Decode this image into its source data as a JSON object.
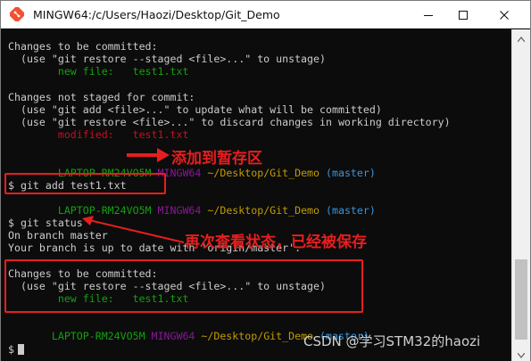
{
  "window": {
    "title": "MINGW64:/c/Users/Haozi/Desktop/Git_Demo"
  },
  "terminal": {
    "lines": [
      {
        "segments": [
          {
            "t": "Changes to be committed:",
            "c": "w"
          }
        ]
      },
      {
        "segments": [
          {
            "t": "  (use \"git restore --staged <file>...\" to unstage)",
            "c": "w"
          }
        ]
      },
      {
        "segments": [
          {
            "t": "        new file:   test1.txt",
            "c": "g"
          }
        ]
      },
      {
        "segments": [
          {
            "t": "",
            "c": "w"
          }
        ]
      },
      {
        "segments": [
          {
            "t": "Changes not staged for commit:",
            "c": "w"
          }
        ]
      },
      {
        "segments": [
          {
            "t": "  (use \"git add <file>...\" to update what will be committed)",
            "c": "w"
          }
        ]
      },
      {
        "segments": [
          {
            "t": "  (use \"git restore <file>...\" to discard changes in working directory)",
            "c": "w"
          }
        ]
      },
      {
        "segments": [
          {
            "t": "        modified:   test1.txt",
            "c": "r"
          }
        ]
      },
      {
        "segments": [
          {
            "t": "",
            "c": "w"
          }
        ]
      },
      {
        "segments": [
          {
            "t": "",
            "c": "w"
          }
        ]
      },
      {
        "segments": [
          {
            "t": "        LAPTOP-RM24VO5M ",
            "c": "g"
          },
          {
            "t": "MINGW64 ",
            "c": "m"
          },
          {
            "t": "~/Desktop/Git_Demo ",
            "c": "y"
          },
          {
            "t": "(master)",
            "c": "c"
          }
        ]
      },
      {
        "segments": [
          {
            "t": "$ git add test1.txt",
            "c": "w"
          }
        ]
      },
      {
        "segments": [
          {
            "t": "",
            "c": "w"
          }
        ]
      },
      {
        "segments": [
          {
            "t": "        LAPTOP-RM24VO5M ",
            "c": "g"
          },
          {
            "t": "MINGW64 ",
            "c": "m"
          },
          {
            "t": "~/Desktop/Git_Demo ",
            "c": "y"
          },
          {
            "t": "(master)",
            "c": "c"
          }
        ]
      },
      {
        "segments": [
          {
            "t": "$ git status",
            "c": "w"
          }
        ]
      },
      {
        "segments": [
          {
            "t": "On branch master",
            "c": "w"
          }
        ]
      },
      {
        "segments": [
          {
            "t": "Your branch is up to date with 'origin/master'.",
            "c": "w"
          }
        ]
      },
      {
        "segments": [
          {
            "t": "",
            "c": "w"
          }
        ]
      },
      {
        "segments": [
          {
            "t": "Changes to be committed:",
            "c": "w"
          }
        ]
      },
      {
        "segments": [
          {
            "t": "  (use \"git restore --staged <file>...\" to unstage)",
            "c": "w"
          }
        ]
      },
      {
        "segments": [
          {
            "t": "        new file:   test1.txt",
            "c": "g"
          }
        ]
      },
      {
        "segments": [
          {
            "t": "",
            "c": "w"
          }
        ]
      },
      {
        "segments": [
          {
            "t": "",
            "c": "w"
          }
        ]
      },
      {
        "segments": [
          {
            "t": "       LAPTOP-RM24VO5M ",
            "c": "g"
          },
          {
            "t": "MINGW64 ",
            "c": "m"
          },
          {
            "t": "~/Desktop/Git_Demo ",
            "c": "y"
          },
          {
            "t": "(master)",
            "c": "c"
          }
        ]
      },
      {
        "segments": [
          {
            "t": "$",
            "c": "w"
          }
        ]
      }
    ]
  },
  "annotations": {
    "added_to_staging": "添加到暂存区",
    "status_again": "再次查看状态，已经被保存"
  },
  "watermark": "CSDN @学习STM32的haozi",
  "colors": {
    "annotation": "#e81e1e",
    "terminal_bg": "#0c0c0c",
    "terminal_fg": "#cccccc",
    "green": "#13a10e",
    "red": "#c50f1f",
    "magenta": "#881798",
    "yellow": "#c19c00",
    "cyan": "#3a96dd"
  },
  "icons": {
    "app": "git-bash-icon",
    "minimize": "minimize-icon",
    "maximize": "maximize-icon",
    "close": "close-icon"
  }
}
